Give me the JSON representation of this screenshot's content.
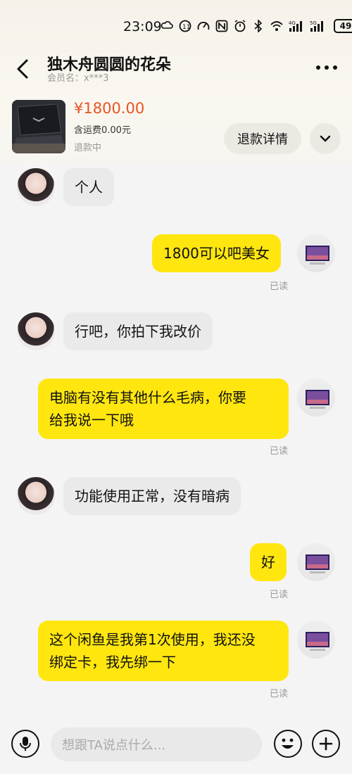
{
  "status_bar": {
    "time": "23:09",
    "battery": "49",
    "signal_1": "4G",
    "signal_2": "5G"
  },
  "header": {
    "title": "独木舟圆圆的花朵",
    "subtitle": "会员名：x***3"
  },
  "product": {
    "price": "¥1800.00",
    "shipping": "含运费0.00元",
    "status": "退款中",
    "refund_button": "退款详情"
  },
  "messages": [
    {
      "from": "other",
      "text_lines": [
        "个人"
      ]
    },
    {
      "from": "self",
      "text_lines": [
        "1800可以吧美女"
      ],
      "read": "已读"
    },
    {
      "from": "other",
      "text_lines": [
        "行吧，你拍下我改价"
      ]
    },
    {
      "from": "self",
      "text_lines": [
        "电脑有没有其他什么毛病，你要",
        "给我说一下哦"
      ],
      "read": "已读"
    },
    {
      "from": "other",
      "text_lines": [
        "功能使用正常，没有暗病"
      ]
    },
    {
      "from": "self",
      "text_lines": [
        "好"
      ],
      "read": "已读"
    },
    {
      "from": "self",
      "text_lines": [
        "这个闲鱼是我第1次使用，我还没",
        "绑定卡，我先绑一下"
      ],
      "read": "已读"
    }
  ],
  "input": {
    "placeholder": "想跟TA说点什么..."
  },
  "colors": {
    "self_bubble": "#ffe60f",
    "other_bubble": "#eaeaea",
    "price": "#e8531f"
  },
  "icons": [
    "back-icon",
    "more-icon",
    "chevron-down-icon",
    "microphone-icon",
    "emoji-icon",
    "plus-icon"
  ]
}
